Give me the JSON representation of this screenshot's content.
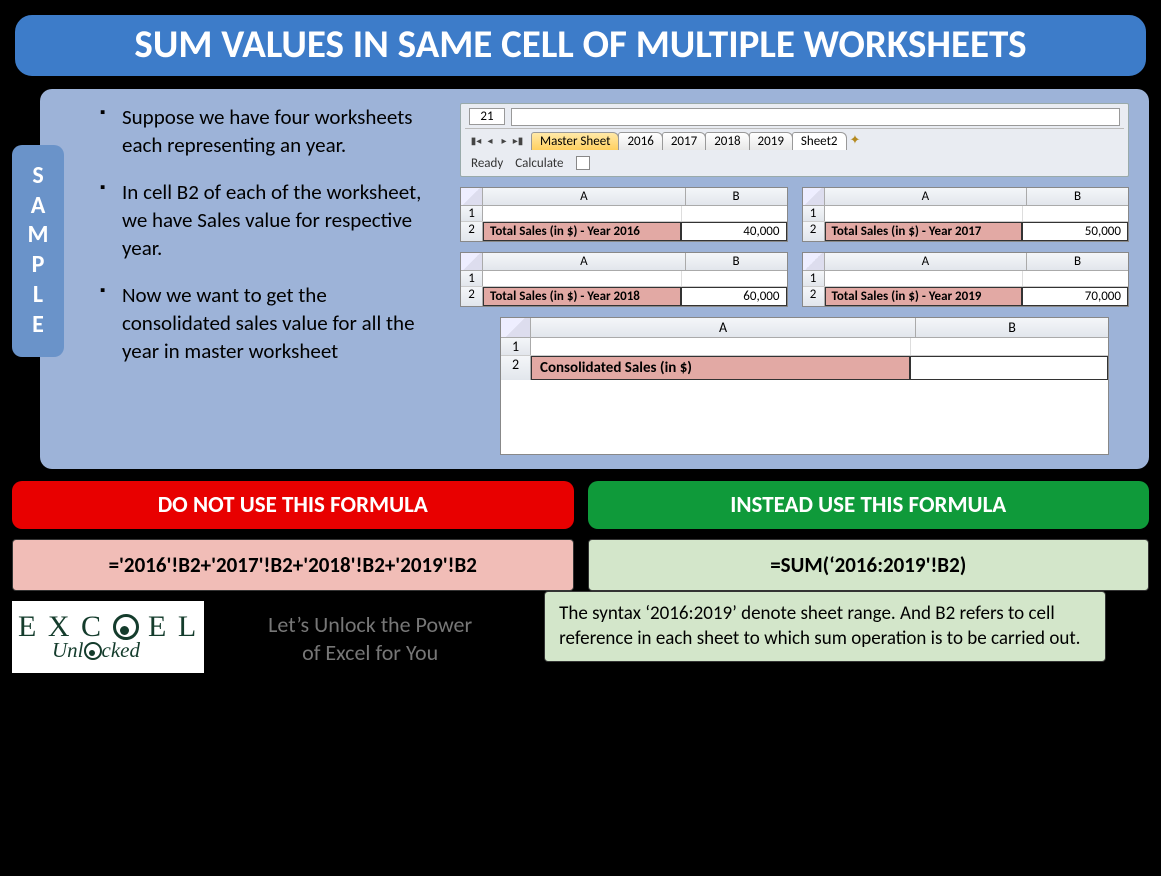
{
  "title": "SUM VALUES IN SAME CELL OF MULTIPLE WORKSHEETS",
  "sample_label": [
    "S",
    "A",
    "M",
    "P",
    "L",
    "E"
  ],
  "bullets": [
    "Suppose we have four worksheets each representing an year.",
    "In cell B2 of each of the worksheet, we have Sales value for respective year.",
    "Now we want to get the consolidated sales value for all the year in master worksheet"
  ],
  "tabbar": {
    "row_number": "21",
    "tabs": [
      "Master Sheet",
      "2016",
      "2017",
      "2018",
      "2019",
      "Sheet2"
    ],
    "active_index": 0,
    "status_left": "Ready",
    "status_right": "Calculate"
  },
  "mini_grids": [
    {
      "label": "Total Sales (in $) - Year 2016",
      "value": "40,000"
    },
    {
      "label": "Total Sales (in $) - Year 2017",
      "value": "50,000"
    },
    {
      "label": "Total Sales (in $) - Year 2018",
      "value": "60,000"
    },
    {
      "label": "Total Sales (in $) - Year 2019",
      "value": "70,000"
    }
  ],
  "col_A": "A",
  "col_B": "B",
  "row1": "1",
  "row2": "2",
  "consolidated_label": "Consolidated Sales (in $)",
  "do_not_header": "DO NOT USE THIS FORMULA",
  "instead_header": "INSTEAD USE THIS FORMULA",
  "bad_formula": "='2016'!B2+'2017'!B2+'2018'!B2+'2019'!B2",
  "good_formula": "=SUM(‘2016:2019'!B2)",
  "note": "The syntax ‘2016:2019’ denote sheet range. And B2 refers to cell reference in each sheet to which sum operation is to be carried out.",
  "logo_top": "E X C   E L",
  "logo_sub": "Unl   cked",
  "tagline1": "Let’s Unlock the Power",
  "tagline2": "of Excel for You"
}
